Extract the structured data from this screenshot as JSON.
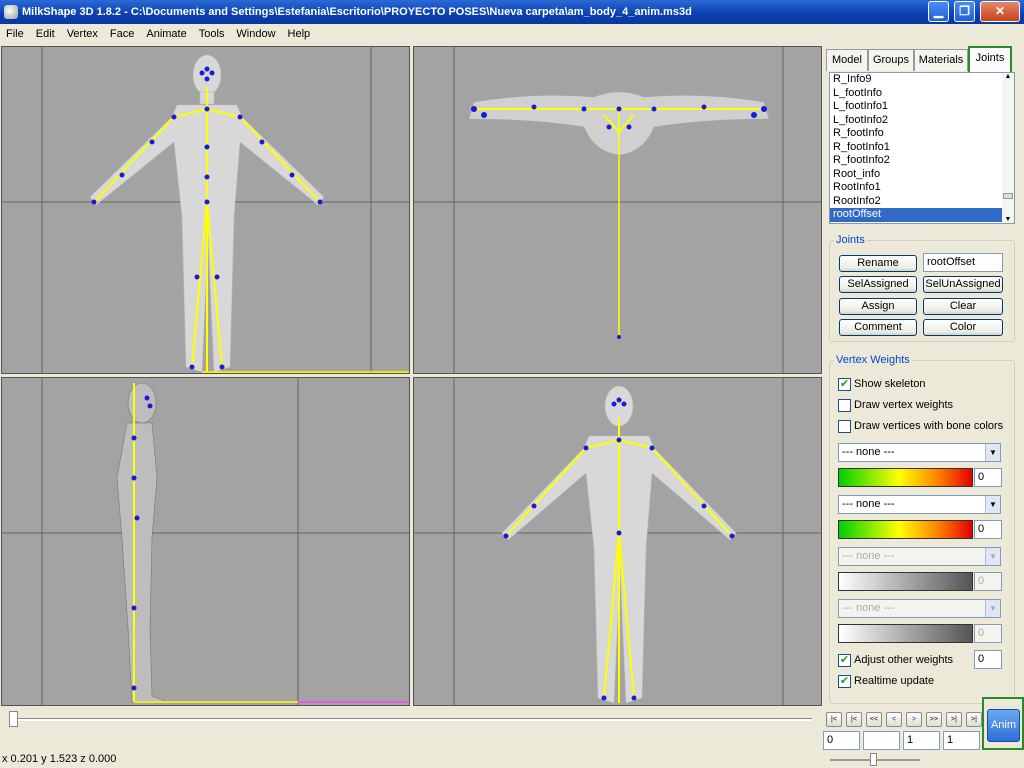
{
  "window": {
    "title": "MilkShape 3D 1.8.2 - C:\\Documents and Settings\\Estefania\\Escritorio\\PROYECTO POSES\\Nueva carpeta\\am_body_4_anim.ms3d",
    "minimize": "▁",
    "maximize": "❐",
    "close": "✕"
  },
  "menu": [
    "File",
    "Edit",
    "Vertex",
    "Face",
    "Animate",
    "Tools",
    "Window",
    "Help"
  ],
  "tabs": [
    "Model",
    "Groups",
    "Materials",
    "Joints"
  ],
  "active_tab": "Joints",
  "joint_list": {
    "items": [
      "R_Info9",
      "L_footInfo",
      "L_footInfo1",
      "L_footInfo2",
      "R_footInfo",
      "R_footInfo1",
      "R_footInfo2",
      "Root_info",
      "RootInfo1",
      "RootInfo2",
      "rootOffset"
    ],
    "selected": "rootOffset"
  },
  "joints_group": {
    "legend": "Joints",
    "rename_label": "Rename",
    "name_value": "rootOffset",
    "selassigned_label": "SelAssigned",
    "selunassigned_label": "SelUnAssigned",
    "assign_label": "Assign",
    "clear_label": "Clear",
    "comment_label": "Comment",
    "color_label": "Color"
  },
  "vertex_weights": {
    "legend": "Vertex Weights",
    "show_skeleton": {
      "label": "Show skeleton",
      "checked": true
    },
    "draw_vertex_weights": {
      "label": "Draw vertex weights",
      "checked": false
    },
    "draw_bone_colors": {
      "label": "Draw vertices with bone colors",
      "checked": false
    },
    "selects": [
      {
        "value": "--- none ---",
        "weight": "0",
        "enabled": true
      },
      {
        "value": "--- none ---",
        "weight": "0",
        "enabled": true
      },
      {
        "value": "--- none ---",
        "weight": "0",
        "enabled": false
      },
      {
        "value": "--- none ---",
        "weight": "0",
        "enabled": false
      }
    ],
    "adjust_other": {
      "label": "Adjust other weights",
      "checked": true,
      "value": "0"
    },
    "realtime": {
      "label": "Realtime update",
      "checked": true
    }
  },
  "playback": {
    "buttons": [
      "|<",
      "|<",
      "<<",
      "<",
      ">",
      ">>",
      ">|",
      ">|"
    ],
    "frame_current": "0",
    "frame_blank": "",
    "frame_start": "1",
    "frame_end": "1",
    "anim_label": "Anim"
  },
  "status": "x 0.201 y 1.523 z 0.000"
}
